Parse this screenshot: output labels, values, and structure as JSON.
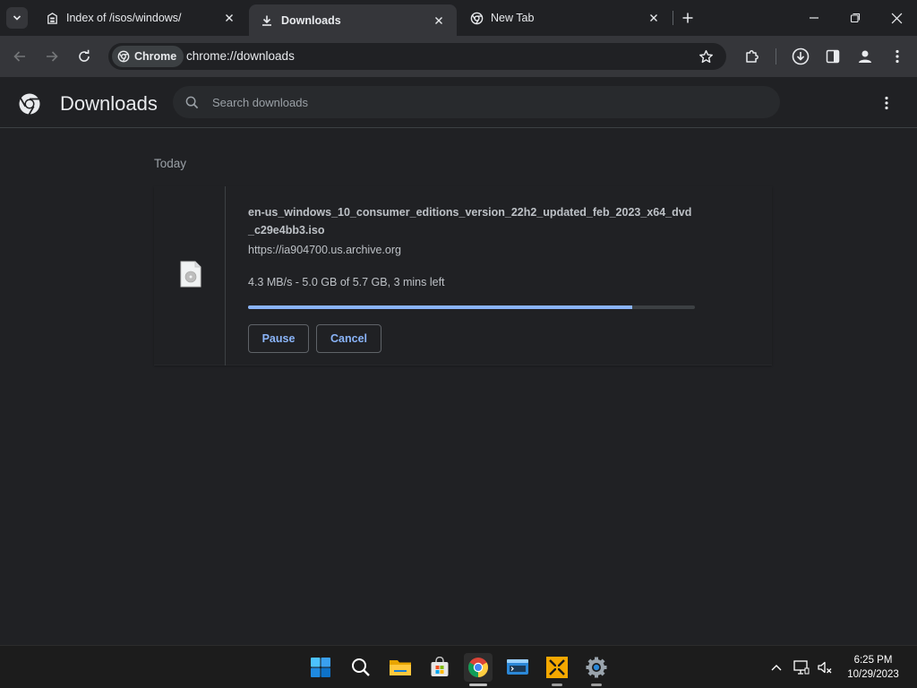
{
  "browser": {
    "tabs": [
      {
        "title": "Index of /isos/windows/",
        "icon": "archive-icon",
        "active": false
      },
      {
        "title": "Downloads",
        "icon": "download-icon",
        "active": true
      },
      {
        "title": "New Tab",
        "icon": "chrome-icon",
        "active": false
      }
    ],
    "omnibox": {
      "chip_label": "Chrome",
      "url": "chrome://downloads"
    }
  },
  "downloads_page": {
    "title": "Downloads",
    "search_placeholder": "Search downloads",
    "date_heading": "Today",
    "item": {
      "file_name": "en-us_windows_10_consumer_editions_version_22h2_updated_feb_2023_x64_dvd_c29e4bb3.iso",
      "source_url": "https://ia904700.us.archive.org",
      "status": "4.3 MB/s - 5.0 GB of 5.7 GB, 3 mins left",
      "progress_percent": 86,
      "pause_label": "Pause",
      "cancel_label": "Cancel"
    }
  },
  "taskbar": {
    "apps": [
      "start-icon",
      "search-icon",
      "file-explorer-icon",
      "store-icon",
      "chrome-icon",
      "terminal-icon",
      "vmware-icon",
      "settings-icon"
    ],
    "clock": {
      "time": "6:25 PM",
      "date": "10/29/2023"
    }
  },
  "colors": {
    "accent": "#8ab4f8",
    "background": "#202124",
    "toolbar": "#35363a"
  }
}
